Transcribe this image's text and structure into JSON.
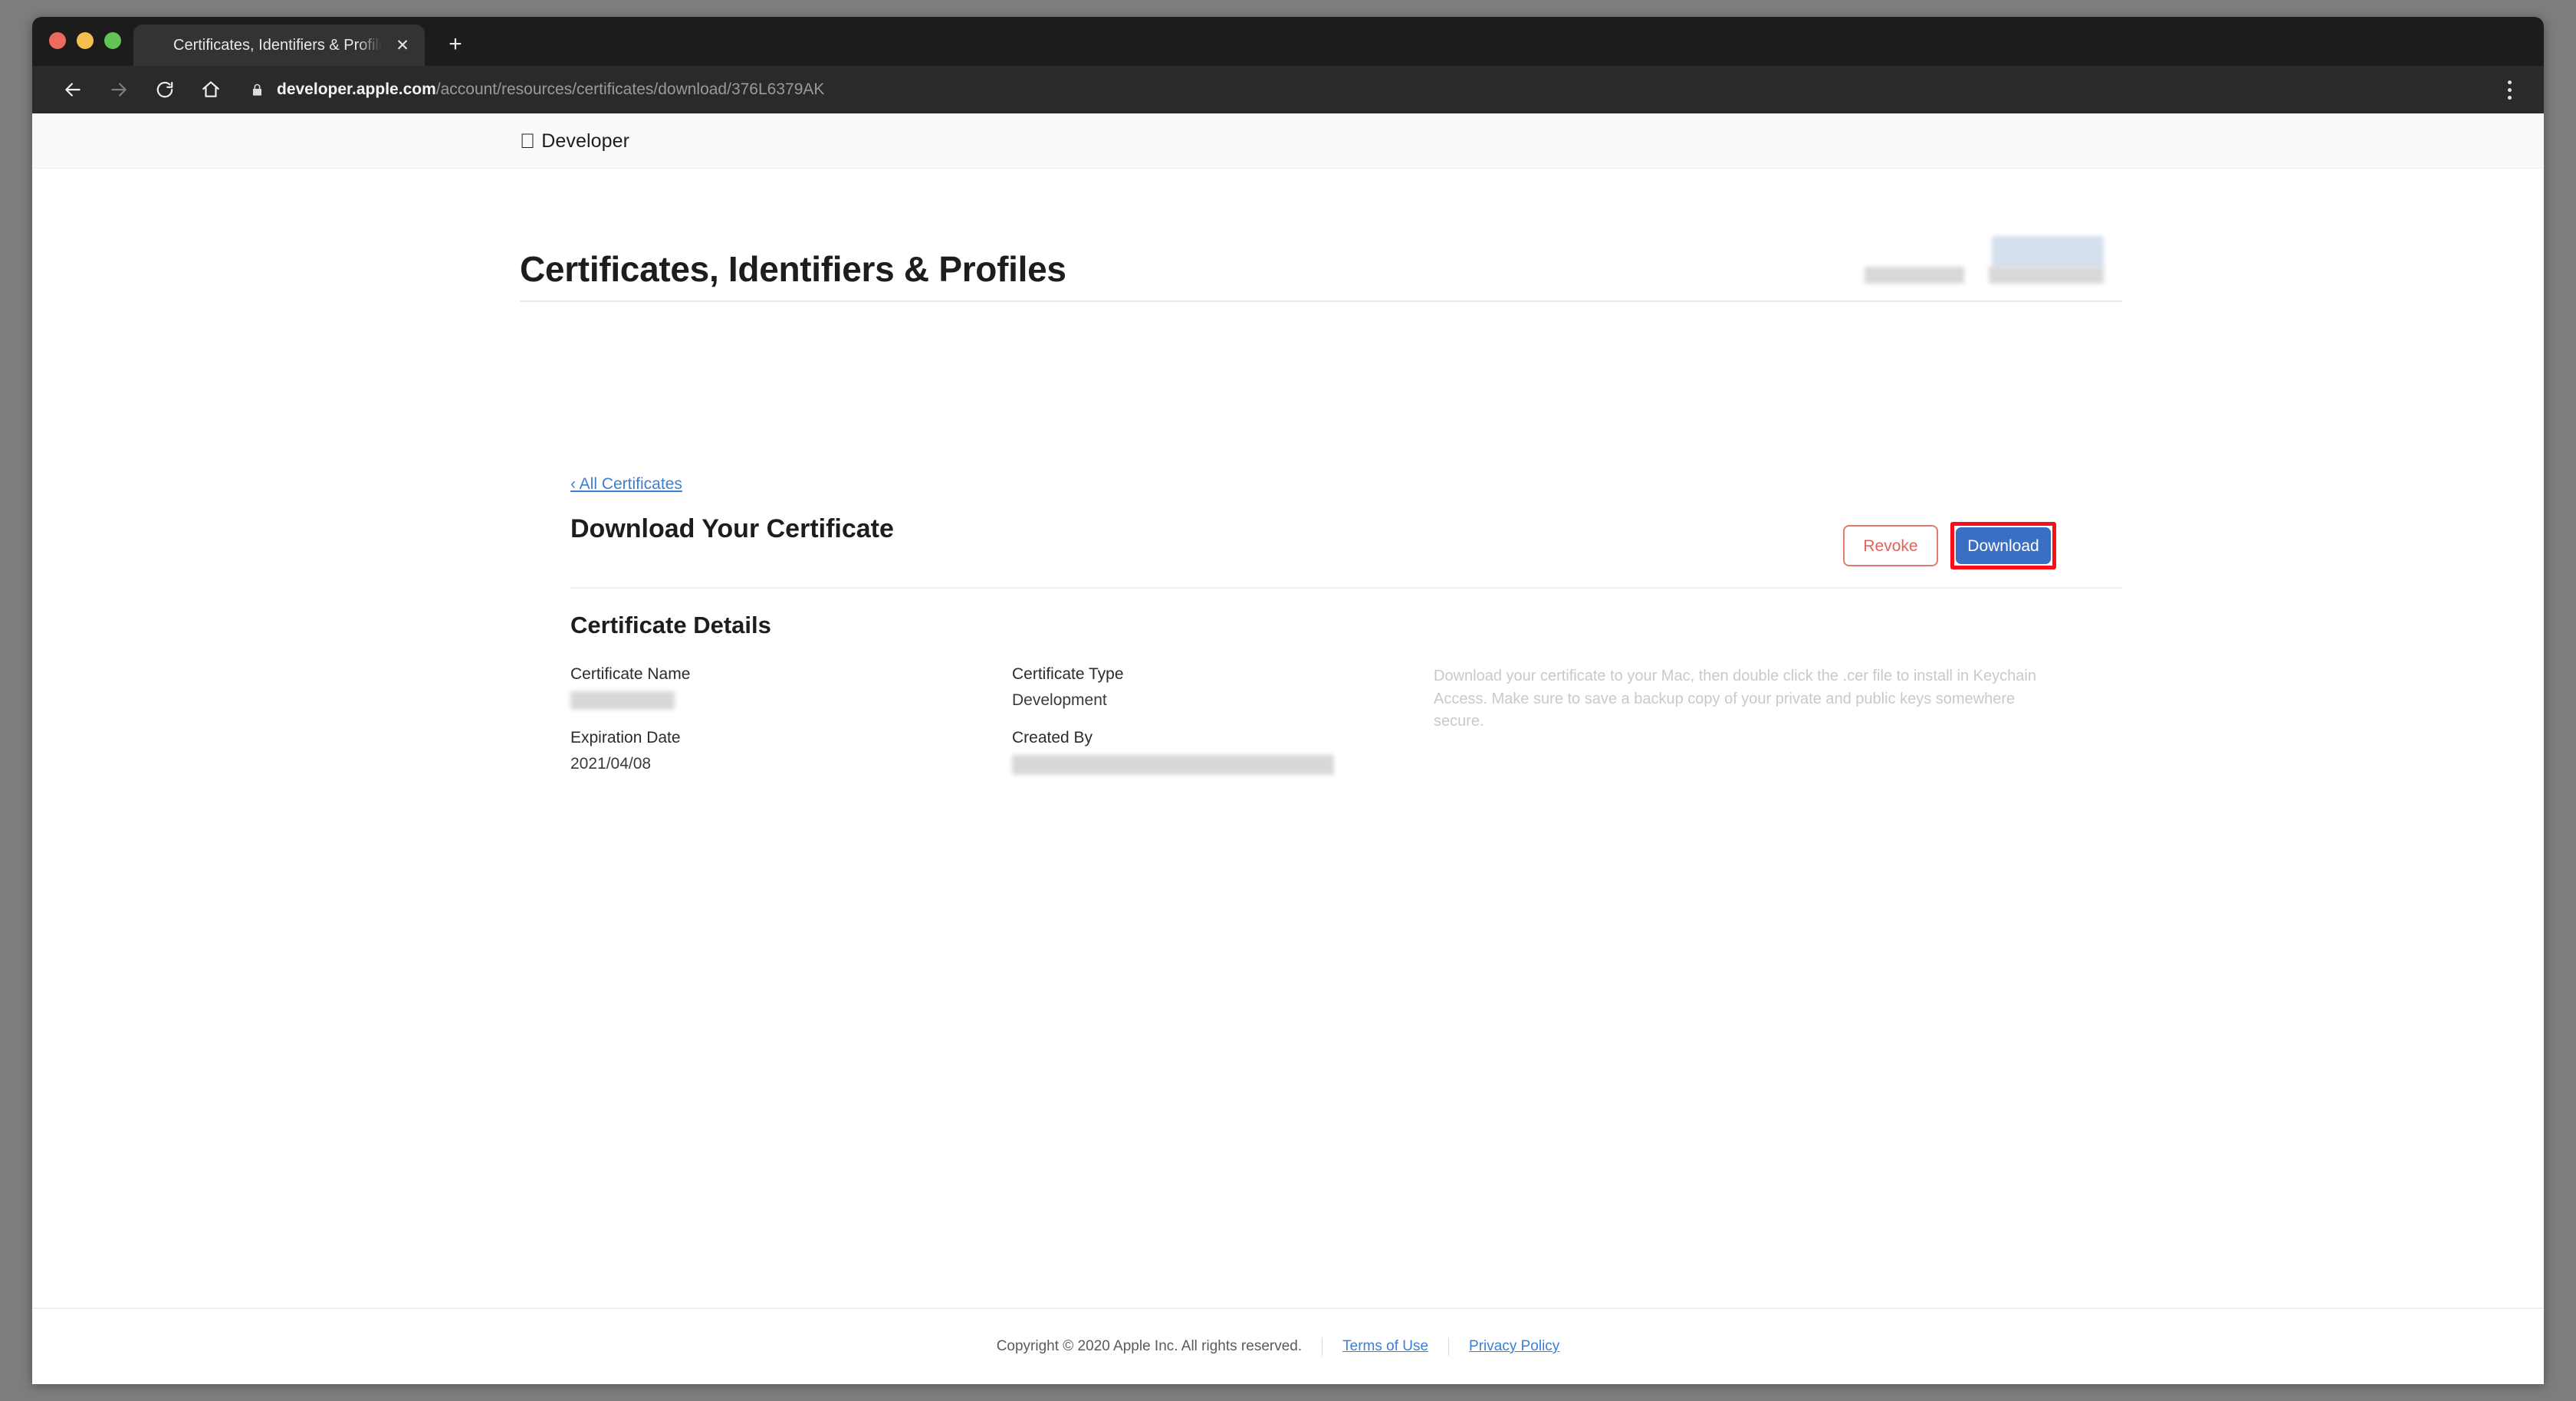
{
  "browser": {
    "traffic_lights": [
      "close",
      "minimize",
      "maximize"
    ],
    "tab": {
      "favicon": "apple-icon",
      "title": "Certificates, Identifiers & Profiles",
      "close_label": "✕"
    },
    "new_tab_label": "+",
    "nav": {
      "back": "back-arrow-icon",
      "forward": "forward-arrow-icon",
      "reload": "reload-icon",
      "home": "home-icon",
      "menu": "three-dot-menu-icon"
    },
    "omnibox": {
      "lock": "lock-icon",
      "url_domain": "developer.apple.com",
      "url_path": "/account/resources/certificates/download/376L6379AK"
    }
  },
  "site_header": {
    "apple_glyph": "",
    "brand": "Developer"
  },
  "page": {
    "title": "Certificates, Identifiers & Profiles",
    "breadcrumb": "‹ All Certificates",
    "section_title": "Download Your Certificate",
    "buttons": {
      "revoke": "Revoke",
      "download": "Download"
    },
    "details": {
      "heading": "Certificate Details",
      "fields": [
        {
          "label": "Certificate Name",
          "value": "",
          "redacted": true
        },
        {
          "label": "Certificate Type",
          "value": "Development",
          "redacted": false
        },
        {
          "label": "Expiration Date",
          "value": "2021/04/08",
          "redacted": false
        },
        {
          "label": "Created By",
          "value": "",
          "redacted": true
        }
      ]
    },
    "help_text": "Download your certificate to your Mac, then double click the .cer file to install in Keychain Access. Make sure to save a backup copy of your private and public keys somewhere secure."
  },
  "footer": {
    "copyright": "Copyright © 2020 Apple Inc. All rights reserved.",
    "terms_link": "Terms of Use",
    "privacy_link": "Privacy Policy"
  },
  "colors": {
    "accent_blue": "#3b6fc4",
    "link_blue": "#3b7fd4",
    "revoke_red": "#e0625a",
    "highlight_red": "#fc0d1c"
  }
}
